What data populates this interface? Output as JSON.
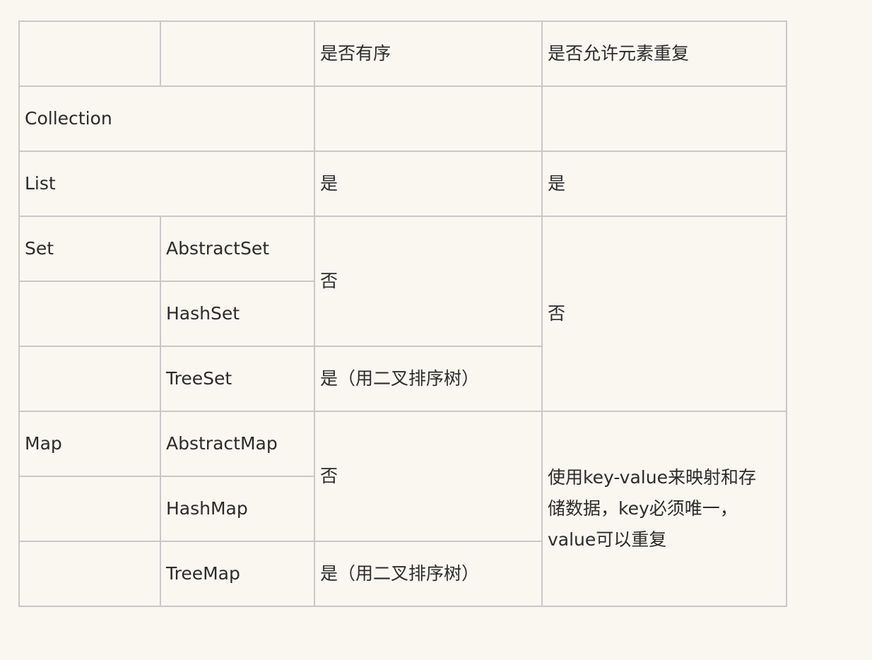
{
  "table": {
    "header": {
      "col3": "是否有序",
      "col4": "是否允许元素重复"
    },
    "collection": {
      "label": "Collection"
    },
    "list": {
      "label": "List",
      "ordered": "是",
      "duplicates": "是"
    },
    "set": {
      "label": "Set",
      "abstract": "AbstractSet",
      "hash": "HashSet",
      "tree": "TreeSet",
      "ordered_abstract_hash": "否",
      "ordered_tree": "是（用二叉排序树）",
      "duplicates": "否"
    },
    "map": {
      "label": "Map",
      "abstract": "AbstractMap",
      "hash": "HashMap",
      "tree": "TreeMap",
      "ordered_abstract_hash": "否",
      "ordered_tree": "是（用二叉排序树）",
      "duplicates": "使用key-value来映射和存储数据，key必须唯一，value可以重复"
    }
  }
}
